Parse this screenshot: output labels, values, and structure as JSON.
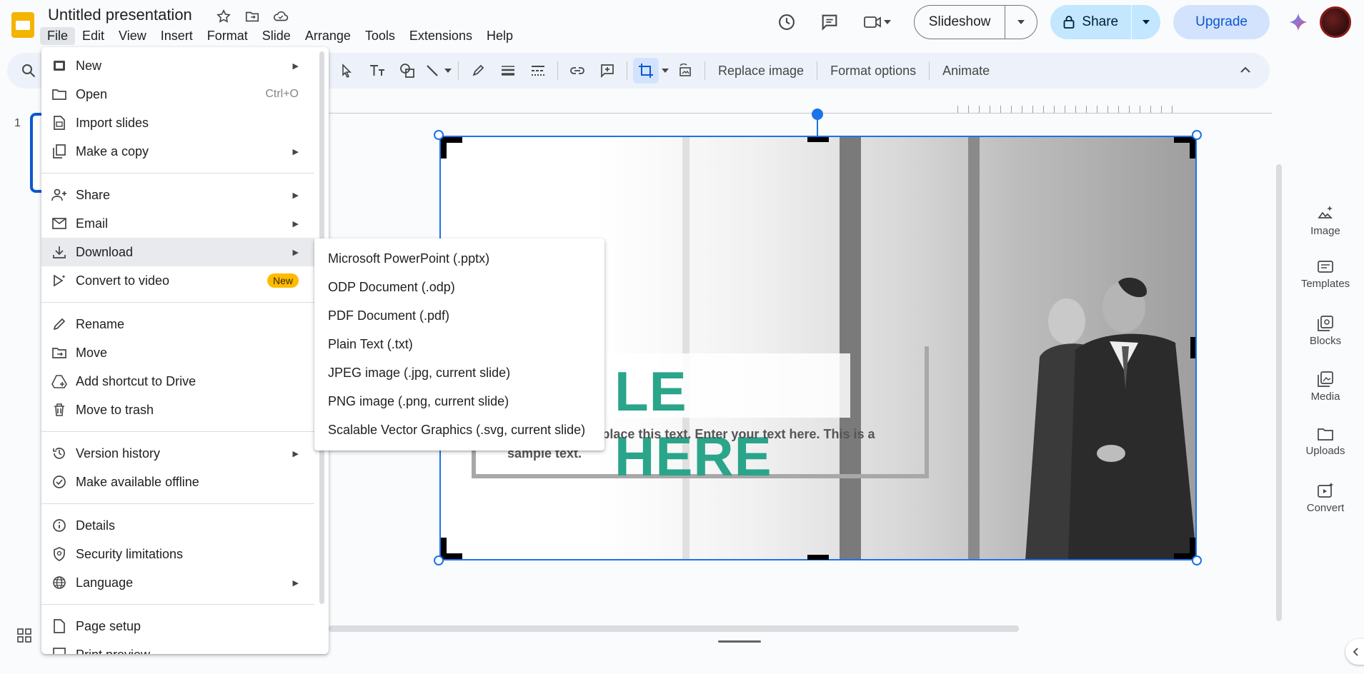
{
  "app": {
    "title": "Untitled presentation",
    "menus": [
      "File",
      "Edit",
      "View",
      "Insert",
      "Format",
      "Slide",
      "Arrange",
      "Tools",
      "Extensions",
      "Help"
    ],
    "active_menu": "File"
  },
  "header": {
    "slideshow_label": "Slideshow",
    "share_label": "Share",
    "upgrade_label": "Upgrade"
  },
  "toolbar": {
    "replace_image": "Replace image",
    "format_options": "Format options",
    "animate": "Animate"
  },
  "filmstrip": {
    "slide_number": "1"
  },
  "slide": {
    "title_fragment": "LE HERE",
    "body_fragment": "text. You can replace this text. Enter your text here. This is a sample text."
  },
  "side_panel": [
    {
      "label": "Image",
      "icon": "image-sparkle-icon"
    },
    {
      "label": "Templates",
      "icon": "templates-icon"
    },
    {
      "label": "Blocks",
      "icon": "blocks-icon"
    },
    {
      "label": "Media",
      "icon": "media-icon"
    },
    {
      "label": "Uploads",
      "icon": "uploads-icon"
    },
    {
      "label": "Convert",
      "icon": "convert-icon"
    }
  ],
  "file_menu": {
    "items": [
      {
        "label": "New",
        "icon": "new-doc-icon",
        "submenu": true
      },
      {
        "label": "Open",
        "icon": "open-folder-icon",
        "shortcut": "Ctrl+O"
      },
      {
        "label": "Import slides",
        "icon": "import-slides-icon"
      },
      {
        "label": "Make a copy",
        "icon": "copy-icon",
        "submenu": true
      },
      {
        "label": "Share",
        "icon": "share-person-icon",
        "submenu": true
      },
      {
        "label": "Email",
        "icon": "email-icon",
        "submenu": true
      },
      {
        "label": "Download",
        "icon": "download-icon",
        "submenu": true,
        "highlighted": true
      },
      {
        "label": "Convert to video",
        "icon": "convert-video-icon",
        "badge": "New"
      },
      {
        "label": "Rename",
        "icon": "pencil-icon"
      },
      {
        "label": "Move",
        "icon": "move-folder-icon"
      },
      {
        "label": "Add shortcut to Drive",
        "icon": "drive-shortcut-icon"
      },
      {
        "label": "Move to trash",
        "icon": "trash-icon"
      },
      {
        "label": "Version history",
        "icon": "history-icon",
        "submenu": true
      },
      {
        "label": "Make available offline",
        "icon": "offline-icon"
      },
      {
        "label": "Details",
        "icon": "info-icon"
      },
      {
        "label": "Security limitations",
        "icon": "security-icon"
      },
      {
        "label": "Language",
        "icon": "globe-icon",
        "submenu": true
      },
      {
        "label": "Page setup",
        "icon": "page-setup-icon"
      },
      {
        "label": "Print preview",
        "icon": "print-preview-icon"
      }
    ]
  },
  "download_menu": {
    "items": [
      "Microsoft PowerPoint (.pptx)",
      "ODP Document (.odp)",
      "PDF Document (.pdf)",
      "Plain Text (.txt)",
      "JPEG image (.jpg, current slide)",
      "PNG image (.png, current slide)",
      "Scalable Vector Graphics (.svg, current slide)"
    ]
  },
  "colors": {
    "accent": "#1a73e8",
    "share_bg": "#c2e7ff",
    "upgrade_bg": "#d3e3fd",
    "new_badge": "#ffbb00",
    "slide_title": "#2aa58a"
  }
}
